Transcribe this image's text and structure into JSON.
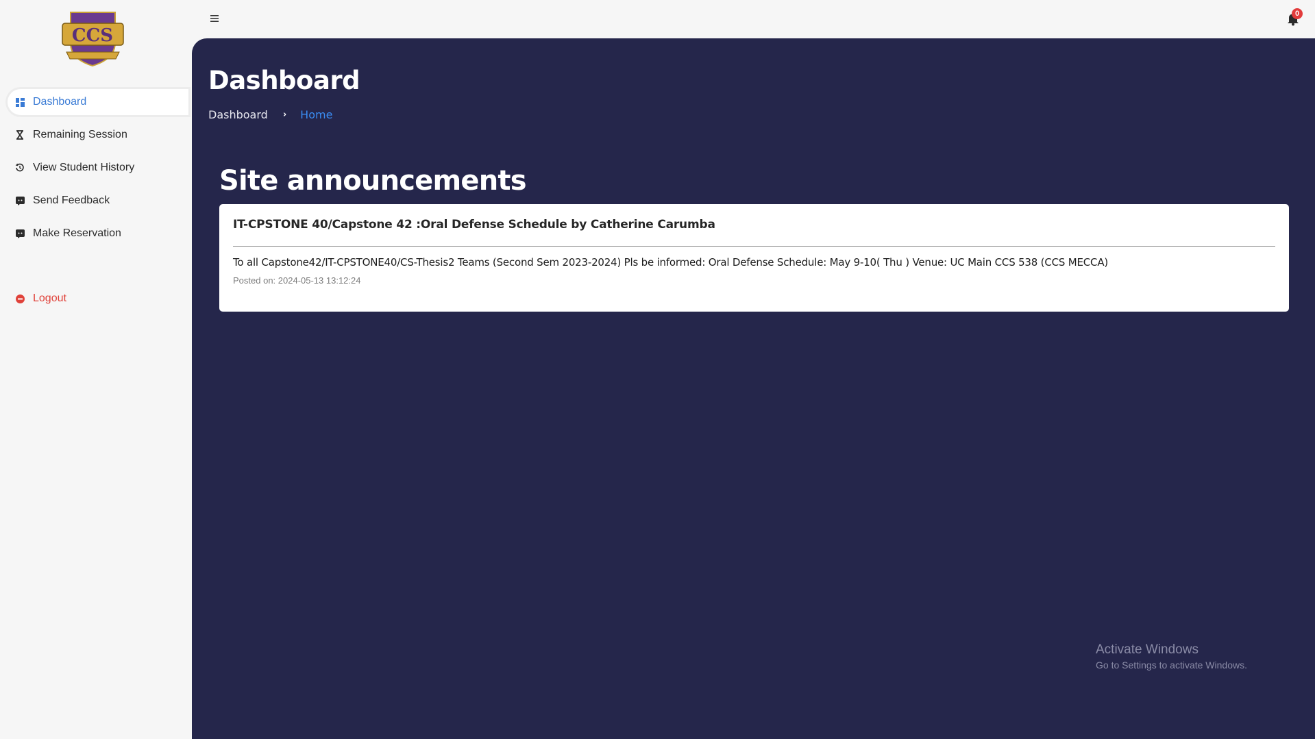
{
  "sidebar": {
    "logo_text": "CCS",
    "items": [
      {
        "label": "Dashboard",
        "icon": "dashboard-grid-icon",
        "active": true
      },
      {
        "label": "Remaining Session",
        "icon": "hourglass-icon"
      },
      {
        "label": "View Student History",
        "icon": "history-icon"
      },
      {
        "label": "Send Feedback",
        "icon": "feedback-icon"
      },
      {
        "label": "Make Reservation",
        "icon": "reservation-icon"
      }
    ],
    "logout_label": "Logout"
  },
  "topbar": {
    "menu_icon": "hamburger-menu-icon",
    "bell_icon": "notification-bell-icon",
    "notification_count": "0"
  },
  "main": {
    "page_title": "Dashboard",
    "breadcrumb": {
      "first": "Dashboard",
      "separator": "›",
      "current": "Home"
    },
    "section_title": "Site announcements",
    "announcement": {
      "title": "IT-CPSTONE 40/Capstone 42 :Oral Defense Schedule by Catherine Carumba",
      "body": "To all Capstone42/IT-CPSTONE40/CS-Thesis2 Teams (Second Sem 2023-2024) Pls be informed: Oral Defense Schedule: May 9-10( Thu ) Venue: UC Main CCS 538 (CCS MECCA)",
      "posted": "Posted on: 2024-05-13 13:12:24"
    }
  },
  "watermark": {
    "title": "Activate Windows",
    "subtitle": "Go to Settings to activate Windows."
  },
  "colors": {
    "main_bg": "#25264b",
    "sidebar_bg": "#f6f6f6",
    "accent_blue": "#3a7bd5",
    "logout_red": "#e0423a",
    "badge_red": "#e23b3b"
  }
}
